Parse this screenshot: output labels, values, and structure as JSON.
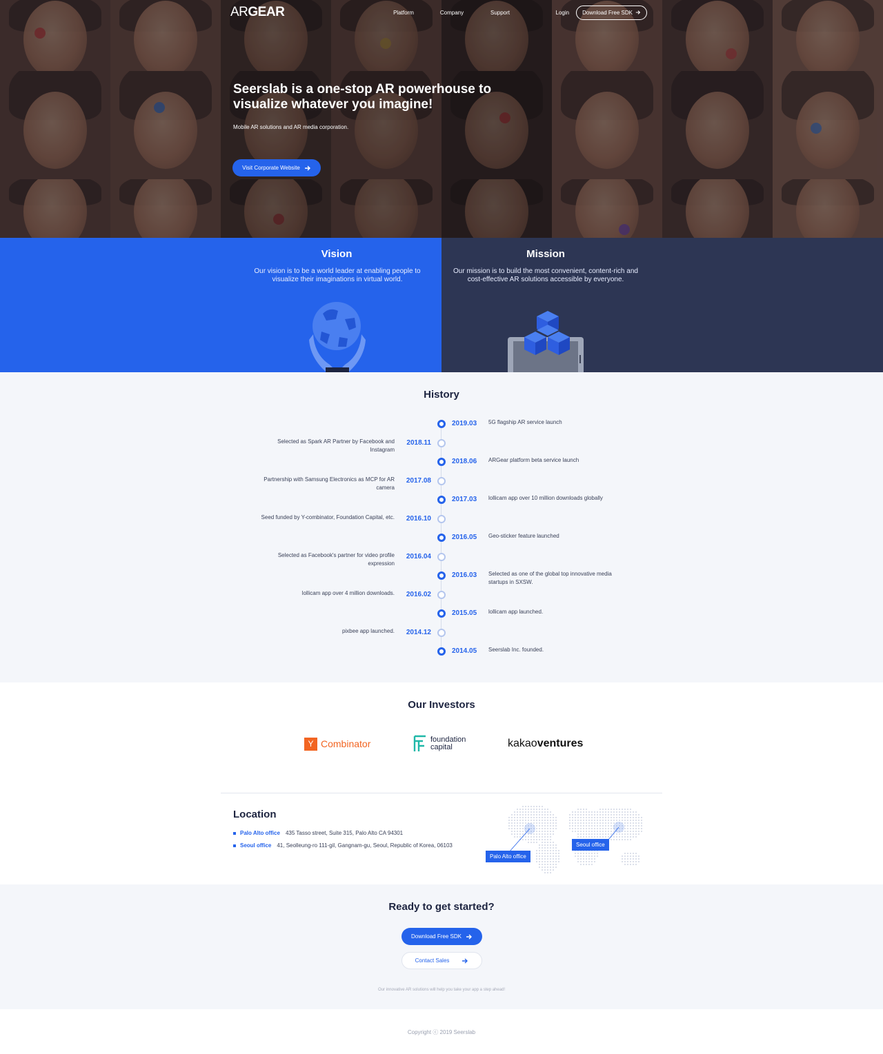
{
  "nav": {
    "logo_ar": "AR",
    "logo_gear": "GEAR",
    "links": [
      "Platform",
      "Company",
      "Support"
    ],
    "login": "Login",
    "download_btn": "Download Free SDK"
  },
  "hero": {
    "title": "Seerslab is a one-stop AR powerhouse to visualize whatever you imagine!",
    "subtitle": "Mobile AR solutions and AR media corporation.",
    "cta": "Visit Corporate Website"
  },
  "vision": {
    "title": "Vision",
    "text": "Our vision is to be a world leader at enabling people to visualize their imaginations in virtual world."
  },
  "mission": {
    "title": "Mission",
    "text": "Our mission is to build the most convenient, content-rich and cost-effective AR solutions accessible by everyone."
  },
  "history": {
    "title": "History",
    "items": [
      {
        "year": "2019.03",
        "text": "5G flagship AR service launch",
        "side": "right"
      },
      {
        "year": "2018.11",
        "text": "Selected as Spark AR Partner by Facebook and Instagram",
        "side": "left"
      },
      {
        "year": "2018.06",
        "text": "ARGear platform beta service launch",
        "side": "right"
      },
      {
        "year": "2017.08",
        "text": "Partnership with Samsung Electronics as MCP for AR camera",
        "side": "left"
      },
      {
        "year": "2017.03",
        "text": "lollicam app over 10 million downloads globally",
        "side": "right"
      },
      {
        "year": "2016.10",
        "text": "Seed funded by Y-combinator, Foundation Capital, etc.",
        "side": "left"
      },
      {
        "year": "2016.05",
        "text": "Geo-sticker feature launched",
        "side": "right"
      },
      {
        "year": "2016.04",
        "text": "Selected as Facebook's partner for video profile expression",
        "side": "left"
      },
      {
        "year": "2016.03",
        "text": "Selected as one of the global top innovative media startups in SXSW.",
        "side": "right"
      },
      {
        "year": "2016.02",
        "text": "lollicam app over 4 million downloads.",
        "side": "left"
      },
      {
        "year": "2015.05",
        "text": "lollicam app launched.",
        "side": "right"
      },
      {
        "year": "2014.12",
        "text": "pixbee app launched.",
        "side": "left"
      },
      {
        "year": "2014.05",
        "text": "Seerslab Inc. founded.",
        "side": "right"
      }
    ]
  },
  "investors": {
    "title": "Our Investors",
    "yc_letter": "Y",
    "yc_name": "Combinator",
    "fc_line1": "foundation",
    "fc_line2": "capital",
    "kakao_a": "kakao",
    "kakao_b": "ventures"
  },
  "location": {
    "title": "Location",
    "offices": [
      {
        "name": "Palo Alto office",
        "address": "435 Tasso street, Suite 315, Palo Alto CA 94301"
      },
      {
        "name": "Seoul office",
        "address": "41, Seolleung-ro 111-gil, Gangnam-gu, Seoul, Republic of Korea, 06103"
      }
    ],
    "map_label_pa": "Palo Alto office",
    "map_label_seoul": "Seoul office"
  },
  "cta": {
    "title": "Ready to get started?",
    "download": "Download Free SDK",
    "contact": "Contact Sales",
    "note": "Our innovative AR solutions will help you take your app a step ahead!"
  },
  "footer": {
    "copyright": "Copyright ⓒ 2019 Seerslab"
  },
  "colors": {
    "accent": "#2563eb",
    "navy": "#2d3654",
    "light_bg": "#f4f6fa",
    "dot_light": "#b4c6ee"
  }
}
